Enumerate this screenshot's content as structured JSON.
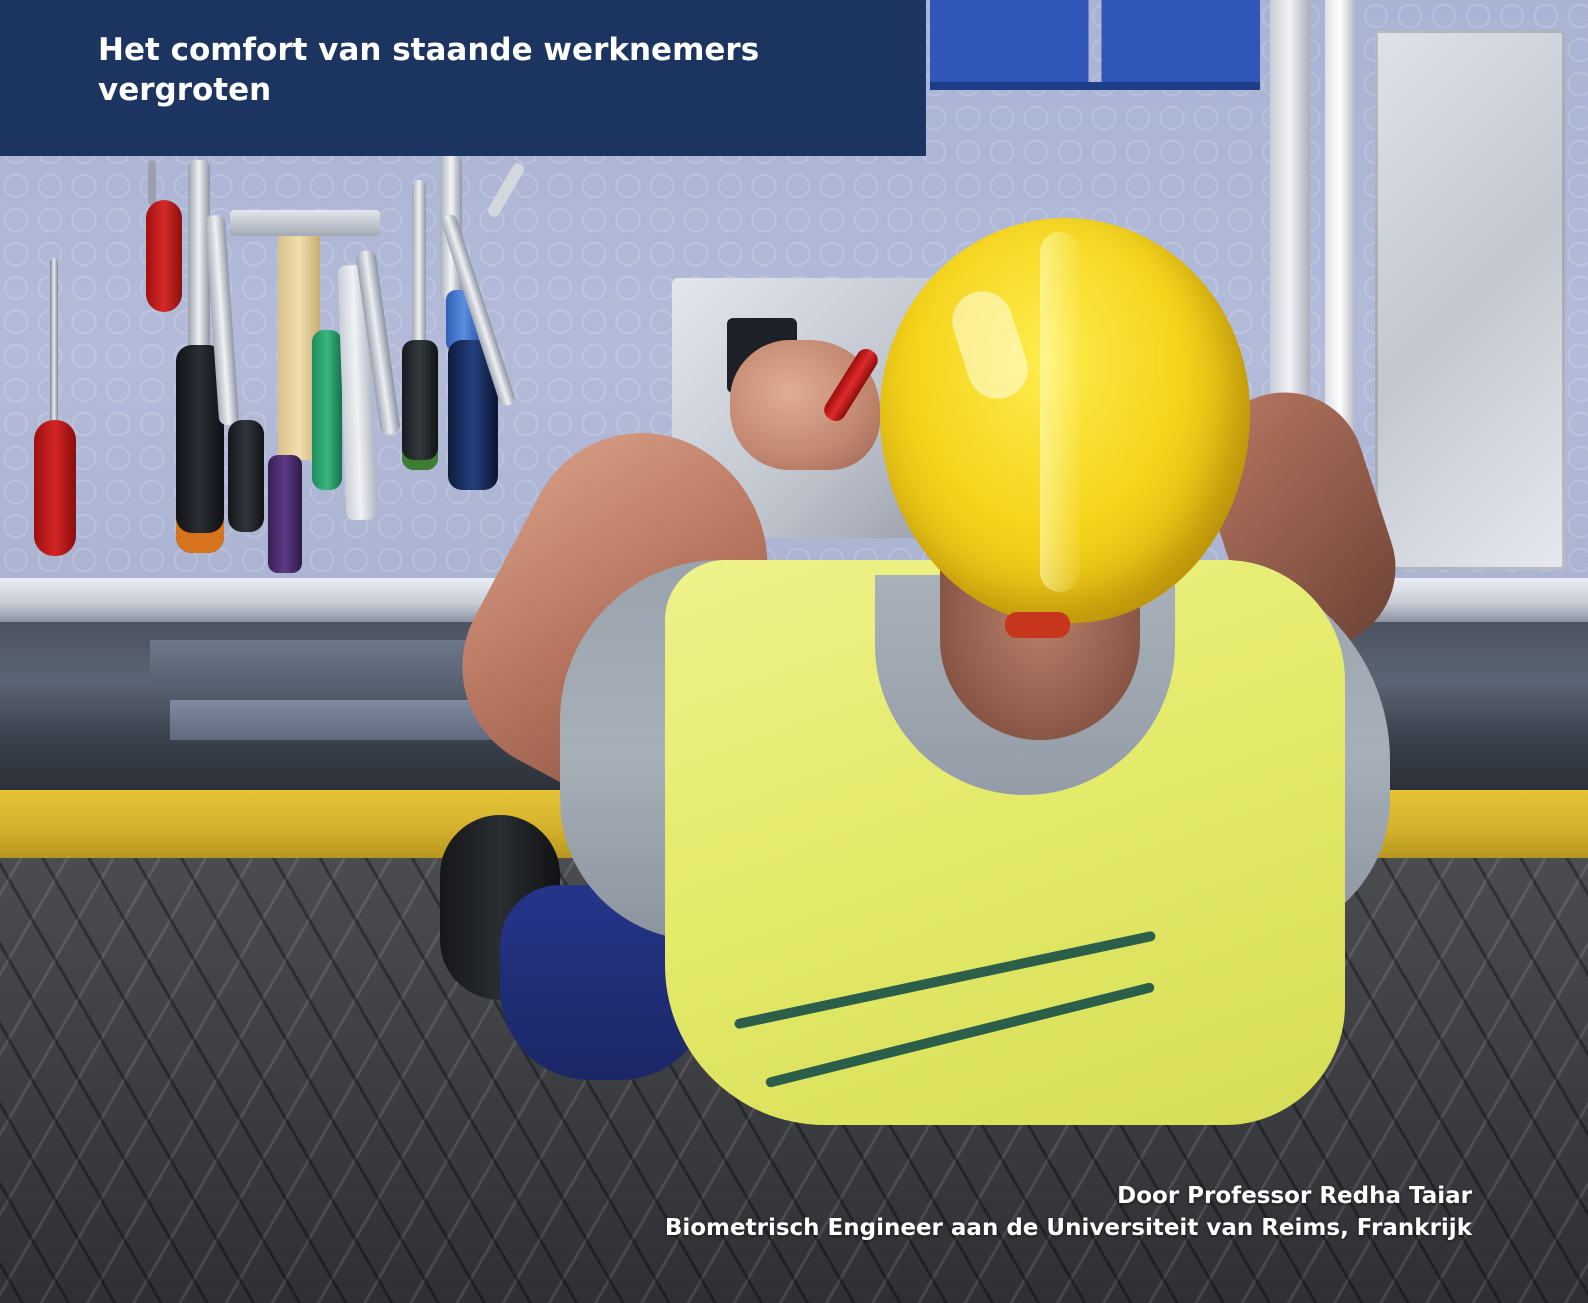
{
  "header": {
    "title": "Het comfort van staande werknemers vergroten"
  },
  "byline": {
    "author": "Door Professor Redha Taiar",
    "affiliation": "Biometrisch Engineer aan de Universiteit van Reims, Frankrijk"
  },
  "colors": {
    "title_panel": "#1b3460",
    "text": "#ffffff",
    "helmet": "#f5d51d",
    "vest": "#e4ea6a",
    "floor_kick": "#d3b02b"
  }
}
